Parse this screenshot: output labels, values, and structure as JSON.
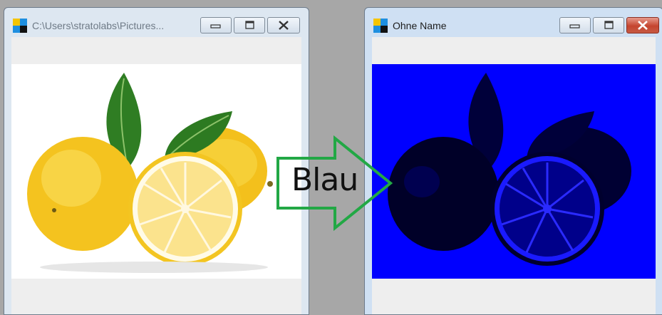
{
  "left_window": {
    "title": "C:\\Users\\stratolabs\\Pictures...",
    "controls": [
      "minimize-icon",
      "maximize-icon",
      "close-icon"
    ]
  },
  "right_window": {
    "title": "Ohne Name",
    "controls": [
      "minimize-icon",
      "maximize-icon",
      "close-icon"
    ]
  },
  "arrow": {
    "label": "Blau",
    "color": "#22a845"
  },
  "colors": {
    "blue_filter": "#0000ff",
    "lemon": "#f7c928",
    "leaf": "#2f7d23"
  }
}
